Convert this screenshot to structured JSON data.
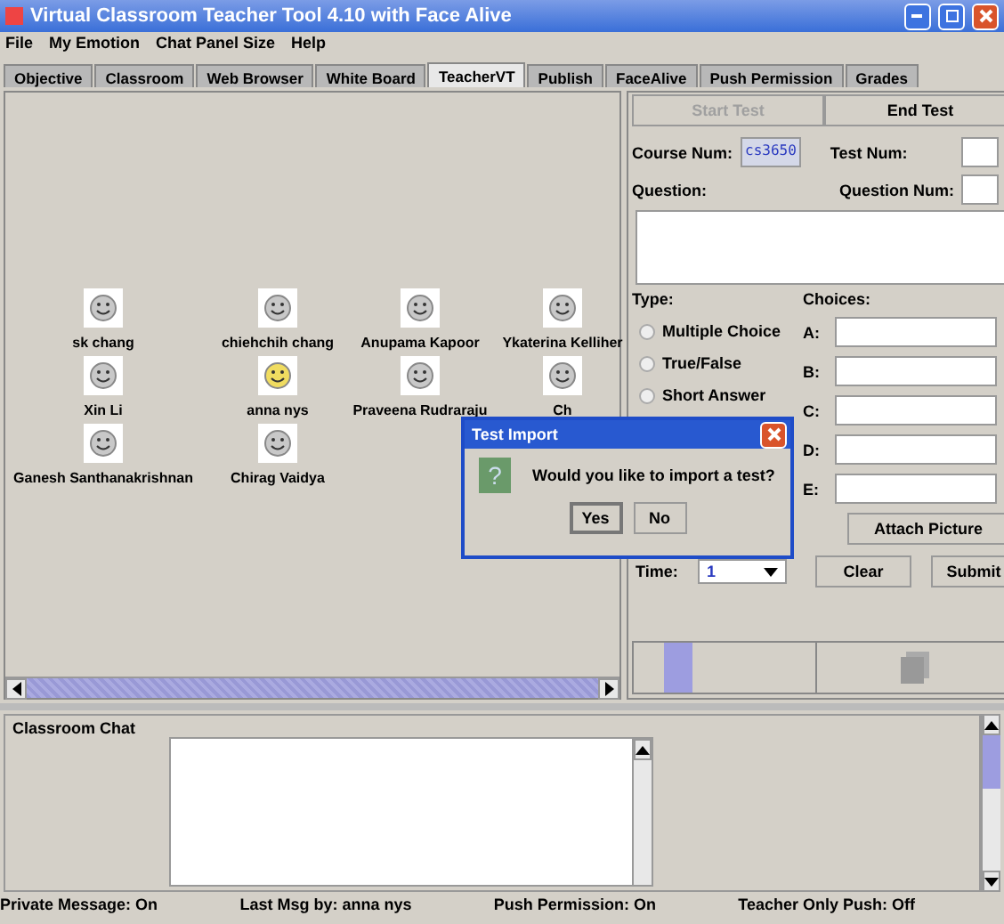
{
  "window": {
    "title": "Virtual Classroom Teacher Tool 4.10 with Face Alive"
  },
  "menu": [
    "File",
    "My Emotion",
    "Chat Panel Size",
    "Help"
  ],
  "tabs": [
    {
      "label": "Objective",
      "selected": false
    },
    {
      "label": "Classroom",
      "selected": false
    },
    {
      "label": "Web Browser",
      "selected": false
    },
    {
      "label": "White Board",
      "selected": false
    },
    {
      "label": "TeacherVT",
      "selected": true
    },
    {
      "label": "Publish",
      "selected": false
    },
    {
      "label": "FaceAlive",
      "selected": false
    },
    {
      "label": "Push Permission",
      "selected": false
    },
    {
      "label": "Grades",
      "selected": false
    }
  ],
  "students": [
    {
      "name": "sk chang",
      "kind": "neutral"
    },
    {
      "name": "chiehchih chang",
      "kind": "neutral"
    },
    {
      "name": "Anupama Kapoor",
      "kind": "neutral"
    },
    {
      "name": "Ykaterina Kelliher",
      "kind": "neutral"
    },
    {
      "name": "Xin Li",
      "kind": "neutral"
    },
    {
      "name": "anna nys",
      "kind": "happy"
    },
    {
      "name": "Praveena Rudraraju",
      "kind": "neutral"
    },
    {
      "name": "Ch",
      "kind": "neutral"
    },
    {
      "name": "Ganesh Santhanakrishnan",
      "kind": "neutral"
    },
    {
      "name": "Chirag Vaidya",
      "kind": "neutral"
    }
  ],
  "test_panel": {
    "start_button": {
      "label": "Start Test",
      "disabled": true
    },
    "end_button": {
      "label": "End Test",
      "disabled": false
    },
    "course_label": "Course Num:",
    "course_value": "cs3650",
    "test_num_label": "Test Num:",
    "question_label": "Question:",
    "question_num_label": "Question Num:",
    "type_label": "Type:",
    "choices_label": "Choices:",
    "types": [
      {
        "label": "Multiple Choice",
        "selected": false
      },
      {
        "label": "True/False",
        "selected": false
      },
      {
        "label": "Short Answer",
        "selected": false
      }
    ],
    "choices": [
      "A:",
      "B:",
      "C:",
      "D:",
      "E:"
    ],
    "attach_button": "Attach Picture",
    "time_label": "Time:",
    "time_value": "1",
    "clear_button": "Clear",
    "submit_button": "Submit"
  },
  "dialog": {
    "title": "Test Import",
    "icon": "?",
    "message": "Would you like to import a test?",
    "buttons": [
      "Yes",
      "No"
    ]
  },
  "chat": {
    "title": "Classroom Chat"
  },
  "status_bar": [
    "Private Message: On",
    "Last Msg by: anna nys",
    "Push Permission: On",
    "Teacher Only Push: Off"
  ]
}
